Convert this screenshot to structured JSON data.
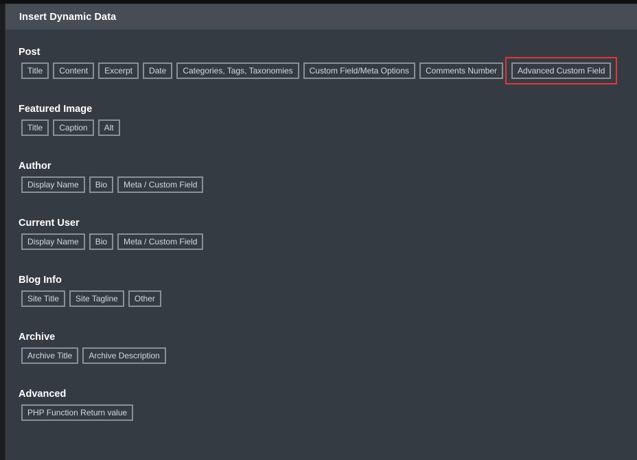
{
  "modal": {
    "title": "Insert Dynamic Data"
  },
  "sections": {
    "post": {
      "title": "Post",
      "items": [
        "Title",
        "Content",
        "Excerpt",
        "Date",
        "Categories, Tags, Taxonomies",
        "Custom Field/Meta Options",
        "Comments Number",
        "Advanced Custom Field"
      ]
    },
    "featured_image": {
      "title": "Featured Image",
      "items": [
        "Title",
        "Caption",
        "Alt"
      ]
    },
    "author": {
      "title": "Author",
      "items": [
        "Display Name",
        "Bio",
        "Meta / Custom Field"
      ]
    },
    "current_user": {
      "title": "Current User",
      "items": [
        "Display Name",
        "Bio",
        "Meta / Custom Field"
      ]
    },
    "blog_info": {
      "title": "Blog Info",
      "items": [
        "Site Title",
        "Site Tagline",
        "Other"
      ]
    },
    "archive": {
      "title": "Archive",
      "items": [
        "Archive Title",
        "Archive Description"
      ]
    },
    "advanced": {
      "title": "Advanced",
      "items": [
        "PHP Function Return value"
      ]
    }
  },
  "colors": {
    "modal_bg": "#353b43",
    "header_bg": "#474d55",
    "tag_border": "#8a9096",
    "highlight": "#e0383b"
  }
}
